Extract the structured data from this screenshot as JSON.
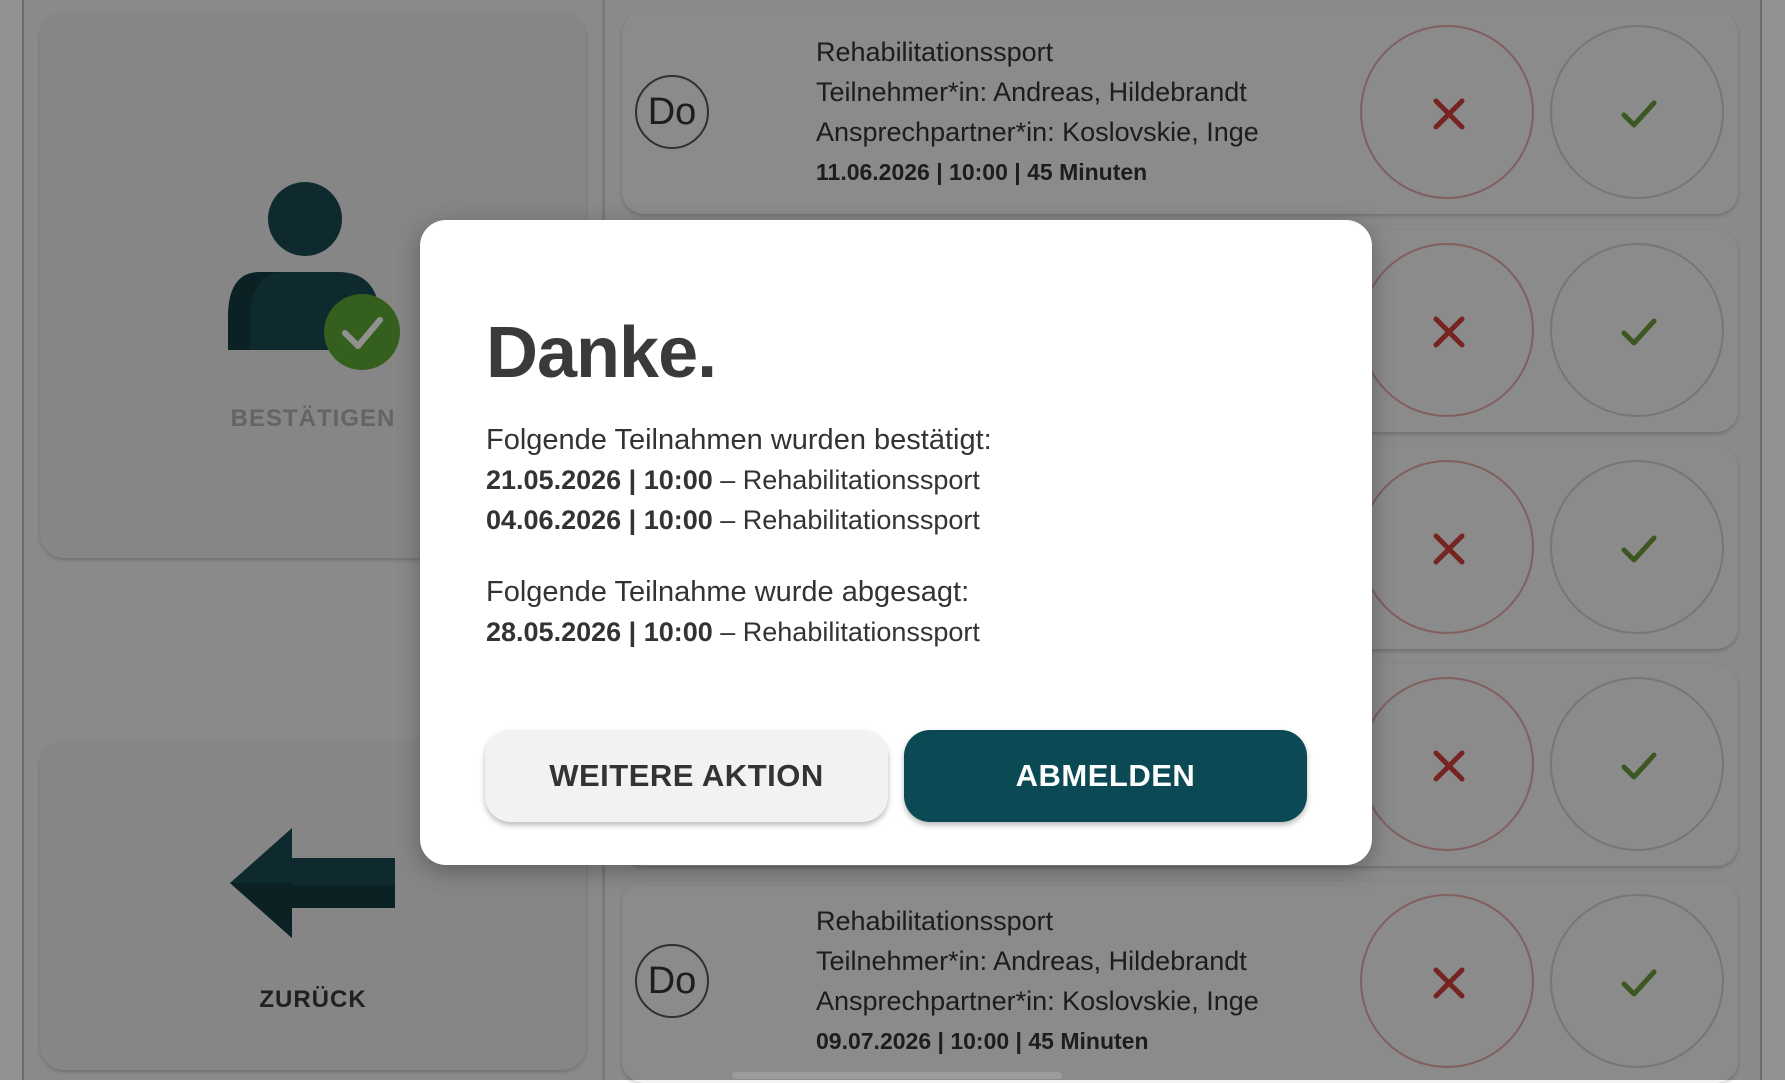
{
  "sidebar": {
    "confirm_label": "BESTÄTIGEN",
    "back_label": "ZURÜCK"
  },
  "appointments": [
    {
      "day": "Do",
      "title": "Rehabilitationssport",
      "participant": "Teilnehmer*in: Andreas, Hildebrandt",
      "contact": "Ansprechpartner*in: Koslovskie, Inge",
      "meta": "11.06.2026 | 10:00 | 45 Minuten"
    },
    {
      "day": "",
      "title": "",
      "participant": "",
      "contact": "",
      "meta": ""
    },
    {
      "day": "",
      "title": "",
      "participant": "",
      "contact": "",
      "meta": ""
    },
    {
      "day": "",
      "title": "",
      "participant": "",
      "contact": "",
      "meta": ""
    },
    {
      "day": "Do",
      "title": "Rehabilitationssport",
      "participant": "Teilnehmer*in: Andreas, Hildebrandt",
      "contact": "Ansprechpartner*in: Koslovskie, Inge",
      "meta": "09.07.2026 | 10:00 | 45 Minuten"
    }
  ],
  "dialog": {
    "title": "Danke.",
    "confirmed_heading": "Folgende Teilnahmen wurden bestätigt:",
    "confirmed": [
      {
        "datetime": "21.05.2026 | 10:00",
        "separator": " – ",
        "course": "Rehabilitationssport"
      },
      {
        "datetime": "04.06.2026 | 10:00",
        "separator": " – ",
        "course": "Rehabilitationssport"
      }
    ],
    "cancelled_heading": "Folgende Teilnahme wurde abgesagt:",
    "cancelled": [
      {
        "datetime": "28.05.2026 | 10:00",
        "separator": " – ",
        "course": "Rehabilitationssport"
      }
    ],
    "secondary_button": "WEITERE AKTION",
    "primary_button": "ABMELDEN"
  },
  "colors": {
    "brand_dark": "#0b4a55",
    "icon_teal": "#1b4a52",
    "confirm_green": "#5ea832",
    "cancel_red": "#d0403a",
    "check_green": "#6a9a3a"
  },
  "icons": {
    "person": "person-check-icon",
    "back": "arrow-left-icon",
    "cancel": "close-icon",
    "confirm": "check-icon"
  }
}
